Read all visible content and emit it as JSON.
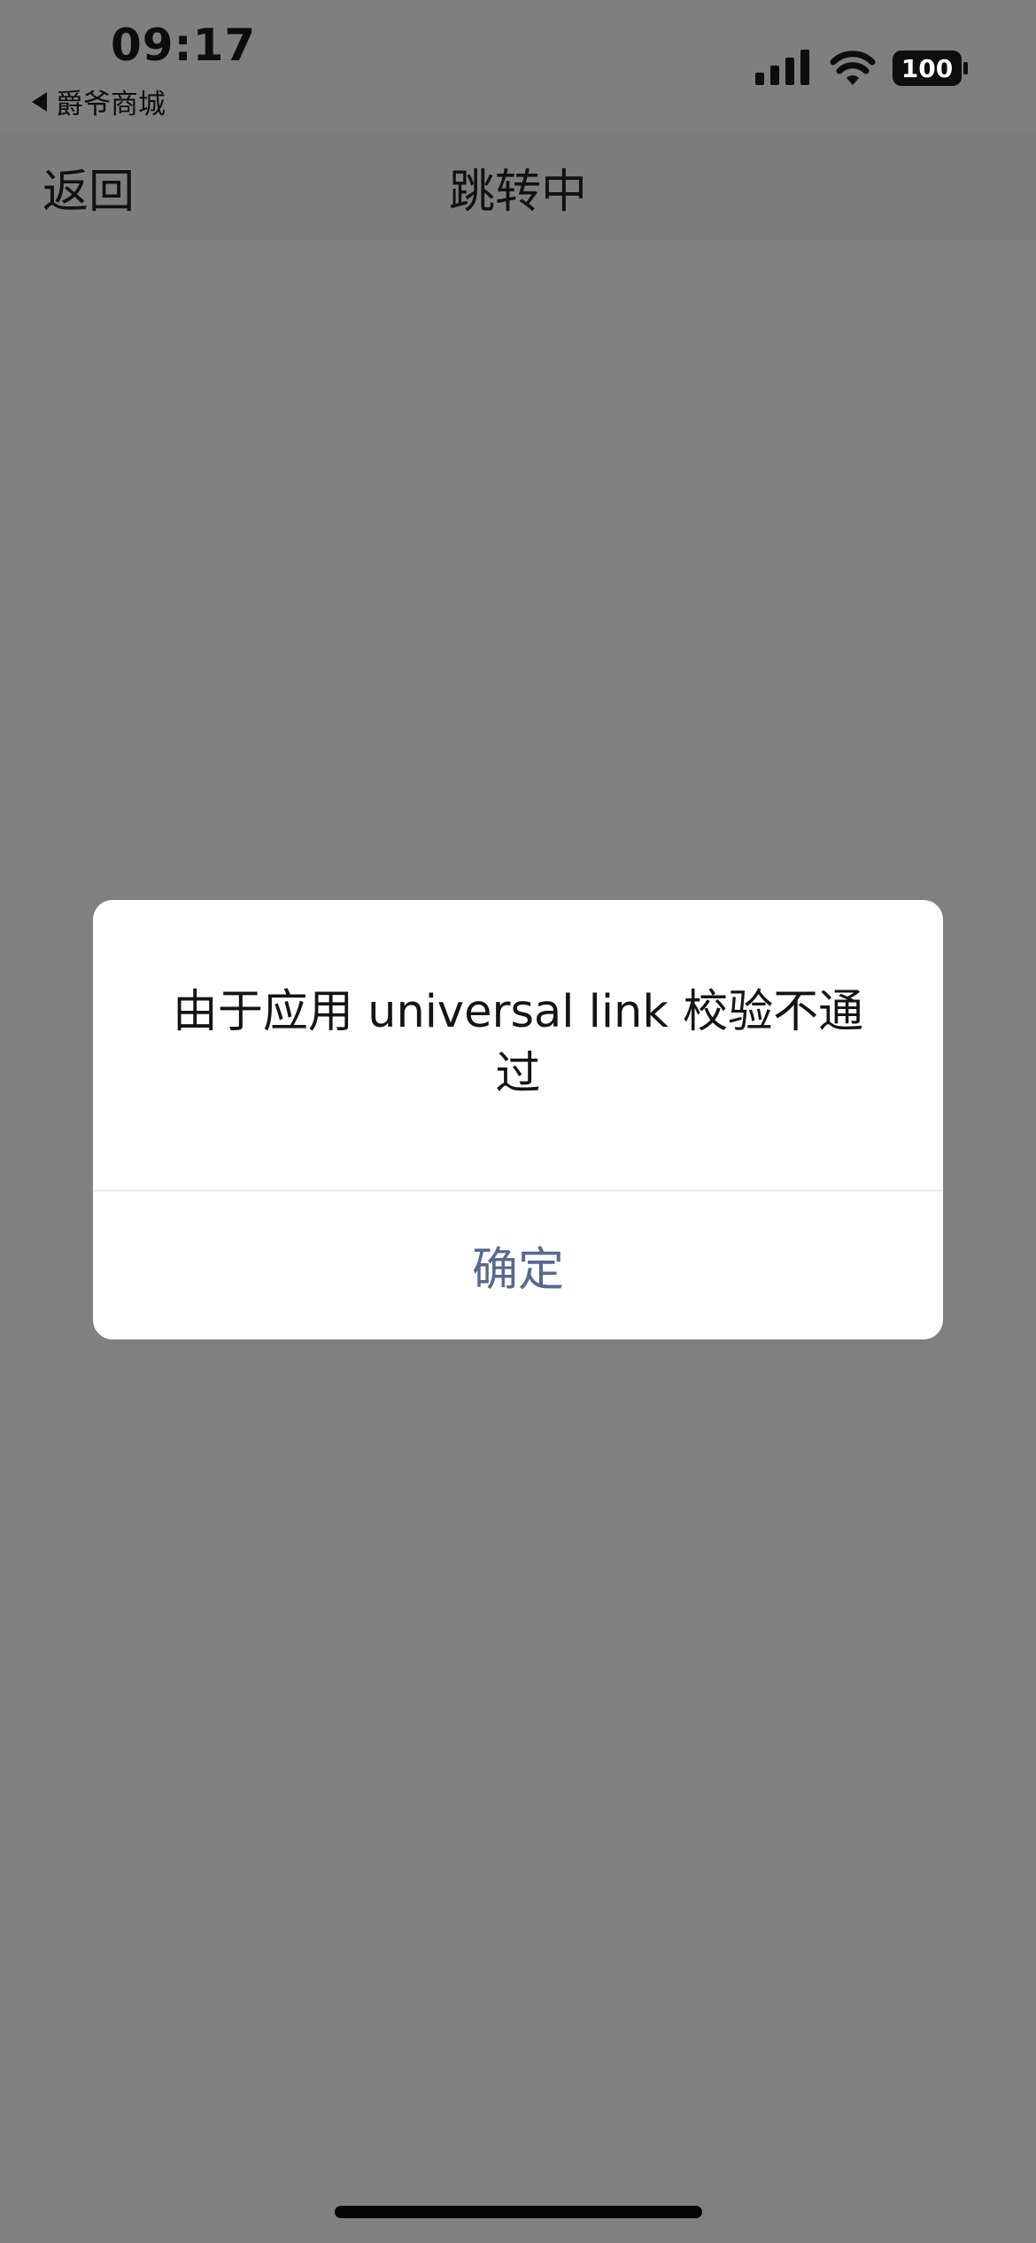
{
  "status_bar": {
    "time": "09:17",
    "back_app_label": "爵爷商城",
    "battery_level": "100",
    "icons": [
      "signal-icon",
      "wifi-icon",
      "battery-icon"
    ]
  },
  "nav_bar": {
    "back_label": "返回",
    "title": "跳转中"
  },
  "dialog": {
    "message": "由于应用 universal link 校验不通过",
    "confirm_label": "确定"
  },
  "colors": {
    "overlay_background": "#808080",
    "dialog_background": "#ffffff",
    "confirm_text": "#56698f"
  }
}
